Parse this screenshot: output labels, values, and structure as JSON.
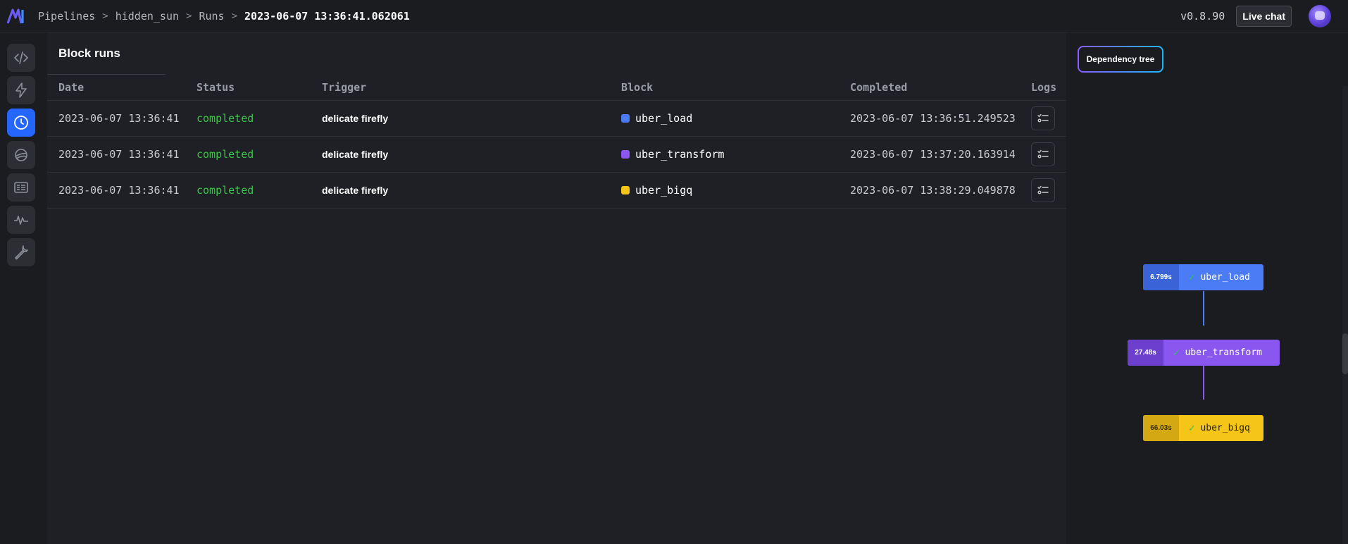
{
  "header": {
    "breadcrumbs": [
      "Pipelines",
      "hidden_sun",
      "Runs",
      "2023-06-07 13:36:41.062061"
    ],
    "separator": ">",
    "version": "v0.8.90",
    "live_chat_label": "Live chat"
  },
  "sidebar": {
    "items": [
      {
        "name": "code-icon",
        "active": false
      },
      {
        "name": "lightning-icon",
        "active": false
      },
      {
        "name": "clock-icon",
        "active": true
      },
      {
        "name": "planet-icon",
        "active": false
      },
      {
        "name": "terminal-icon",
        "active": false
      },
      {
        "name": "activity-icon",
        "active": false
      },
      {
        "name": "wrench-icon",
        "active": false
      }
    ]
  },
  "main": {
    "title": "Block runs",
    "columns": [
      "Date",
      "Status",
      "Trigger",
      "Block",
      "Completed",
      "Logs"
    ],
    "rows": [
      {
        "date": "2023-06-07 13:36:41",
        "status": "completed",
        "trigger": "delicate firefly",
        "block": "uber_load",
        "block_color": "#4b7cf5",
        "completed": "2023-06-07 13:36:51.249523"
      },
      {
        "date": "2023-06-07 13:36:41",
        "status": "completed",
        "trigger": "delicate firefly",
        "block": "uber_transform",
        "block_color": "#8a56f0",
        "completed": "2023-06-07 13:37:20.163914"
      },
      {
        "date": "2023-06-07 13:36:41",
        "status": "completed",
        "trigger": "delicate firefly",
        "block": "uber_bigq",
        "block_color": "#f5c518",
        "completed": "2023-06-07 13:38:29.049878"
      }
    ]
  },
  "panel": {
    "dependency_tree_label": "Dependency tree",
    "nodes": [
      {
        "duration": "6.799s",
        "name": "uber_load",
        "color": "#4b7cf5",
        "dur_color": "#3a63d8"
      },
      {
        "duration": "27.48s",
        "name": "uber_transform",
        "color": "#8a56f0",
        "dur_color": "#6c3fcf"
      },
      {
        "duration": "66.03s",
        "name": "uber_bigq",
        "color": "#f5c518",
        "dur_color": "#d4a812"
      }
    ]
  }
}
